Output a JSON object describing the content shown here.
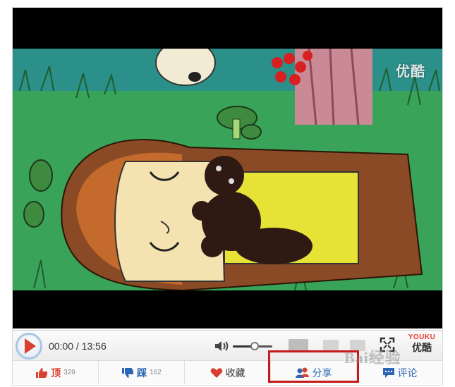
{
  "video": {
    "watermark": "优酷"
  },
  "controls": {
    "time": "00:00 / 13:56",
    "volume_level": 0.55,
    "logo_en": "YOUKU",
    "logo_cn": "优酷"
  },
  "actions": [
    {
      "label": "顶",
      "count": "329"
    },
    {
      "label": "踩",
      "count": "162"
    },
    {
      "label": "收藏",
      "count": ""
    },
    {
      "label": "分享",
      "count": ""
    },
    {
      "label": "评论",
      "count": ""
    }
  ],
  "overlay_watermark": "Bai经验",
  "colors": {
    "accent_red": "#d8412f",
    "accent_blue": "#2a66b5",
    "highlight_box": "#c71a1a"
  }
}
